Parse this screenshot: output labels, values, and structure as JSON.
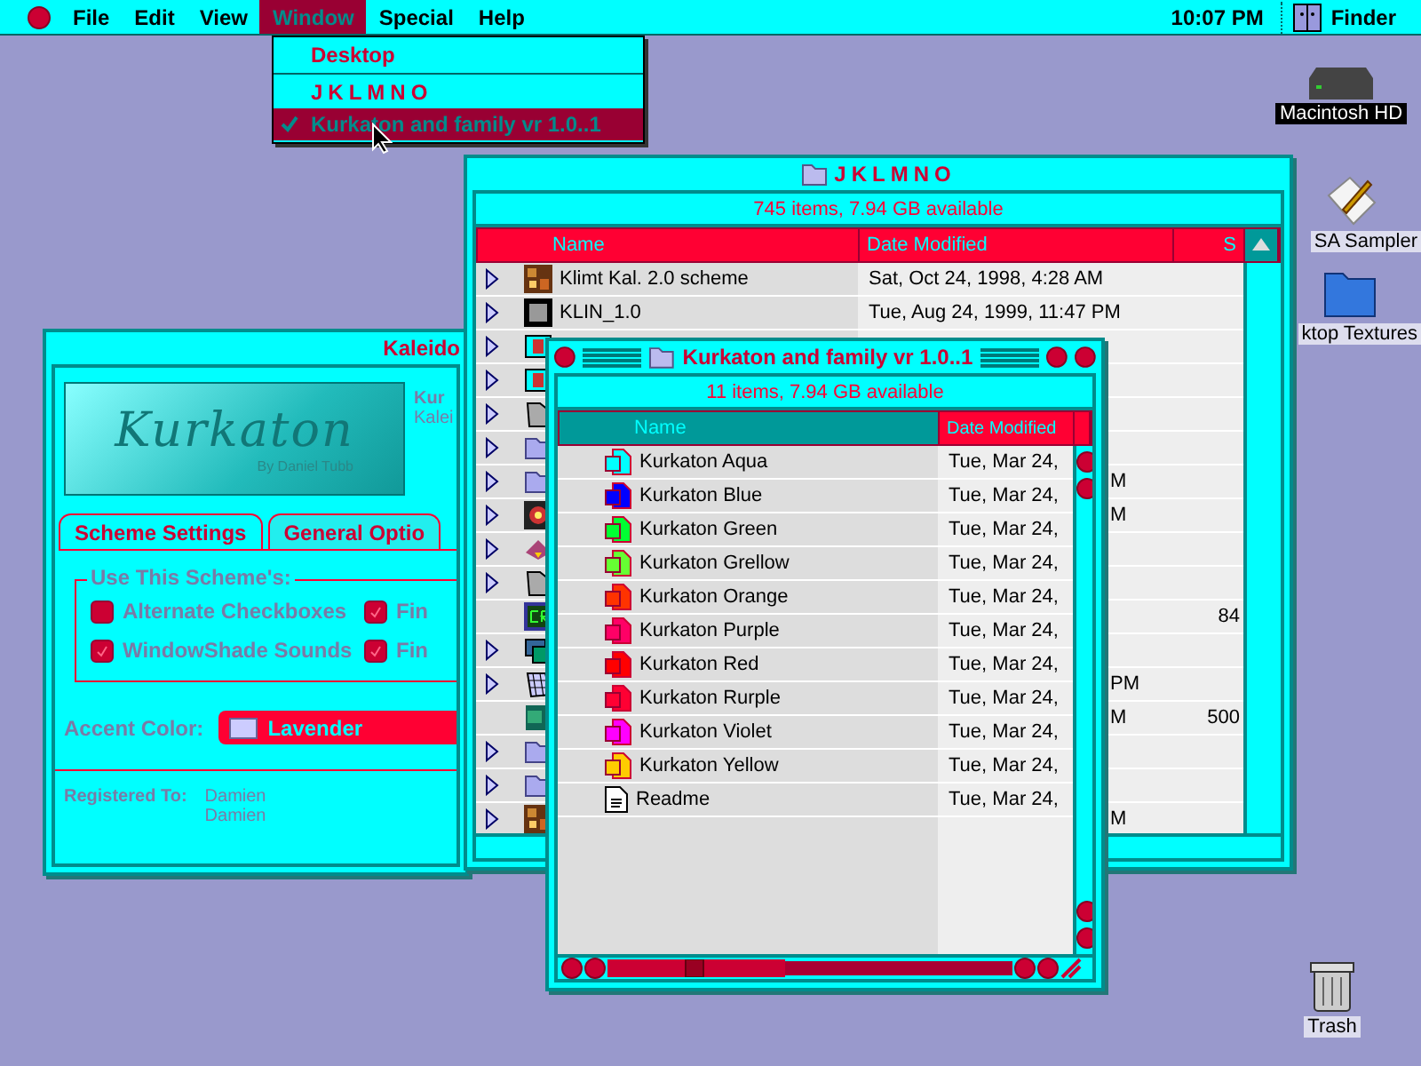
{
  "menu_bar": {
    "menus": [
      {
        "label": "File",
        "selected": false
      },
      {
        "label": "Edit",
        "selected": false
      },
      {
        "label": "View",
        "selected": false
      },
      {
        "label": "Window",
        "selected": true
      },
      {
        "label": "Special",
        "selected": false
      },
      {
        "label": "Help",
        "selected": false
      }
    ],
    "clock": "10:07 PM",
    "app": "Finder"
  },
  "window_menu": {
    "items": [
      {
        "kind": "item",
        "label": "Desktop",
        "checked": false,
        "selected": false
      },
      {
        "kind": "separator"
      },
      {
        "kind": "item",
        "label": "JKLMNO",
        "checked": false,
        "selected": false
      },
      {
        "kind": "item",
        "label": "Kurkaton and family vr 1.0..1",
        "checked": true,
        "selected": true
      }
    ]
  },
  "desktop_icons": [
    {
      "kind": "drive",
      "label": "Macintosh HD",
      "selected": true
    },
    {
      "kind": "app",
      "label": "SA Sampler",
      "selected": false
    },
    {
      "kind": "folder",
      "label": "ktop Textures",
      "selected": false
    },
    {
      "kind": "trash",
      "label": "Trash",
      "selected": false
    }
  ],
  "kaleidoscope_window": {
    "title": "Kaleido",
    "logo": {
      "title": "Kurkaton",
      "byline": "By Daniel Tubb"
    },
    "info": [
      "Kur",
      "Kalei"
    ],
    "tabs": [
      {
        "label": "Scheme Settings",
        "selected": true
      },
      {
        "label": "General Optio",
        "selected": false
      }
    ],
    "group": {
      "title": "Use This Scheme's:",
      "options": [
        {
          "label": "Alternate Checkboxes",
          "checked": false
        },
        {
          "label": "Fin",
          "checked": true
        },
        {
          "label": "WindowShade Sounds",
          "checked": true
        },
        {
          "label": "Fin",
          "checked": true
        }
      ]
    },
    "accent": {
      "label": "Accent Color:",
      "value": "Lavender"
    },
    "registered": {
      "label": "Registered To:",
      "lines": [
        "Damien",
        "Damien"
      ]
    }
  },
  "jklmno_window": {
    "title": "JKLMNO",
    "info": "745 items, 7.94 GB available",
    "columns": [
      "Name",
      "Date Modified",
      "S"
    ],
    "rows": [
      {
        "kind": "mosaic",
        "expandable": true,
        "name": "Klimt Kal. 2.0 scheme",
        "date": "Sat, Oct 24, 1998, 4:28 AM"
      },
      {
        "kind": "klin",
        "expandable": true,
        "name": "KLIN_1.0",
        "date": "Tue, Aug 24, 1999, 11:47 PM"
      },
      {
        "kind": "app",
        "expandable": true
      },
      {
        "kind": "app",
        "expandable": true
      },
      {
        "kind": "dark-folder",
        "expandable": true
      },
      {
        "kind": "folder",
        "expandable": true
      },
      {
        "kind": "folder",
        "expandable": true,
        "date": "M"
      },
      {
        "kind": "emblem",
        "expandable": true,
        "date": "M"
      },
      {
        "kind": "pyramid",
        "expandable": true
      },
      {
        "kind": "dark-folder",
        "expandable": true
      },
      {
        "kind": "cr",
        "expandable": false,
        "size": "84"
      },
      {
        "kind": "stack",
        "expandable": true
      },
      {
        "kind": "grid",
        "expandable": true,
        "date": "PM"
      },
      {
        "kind": "k-app",
        "expandable": false,
        "date": "M",
        "size": "500"
      },
      {
        "kind": "folder",
        "expandable": true
      },
      {
        "kind": "folder",
        "expandable": true
      },
      {
        "kind": "mosaic",
        "expandable": true,
        "date": "M"
      }
    ]
  },
  "kurkaton_window": {
    "title": "Kurkaton and family vr 1.0..1",
    "info": "11 items, 7.94 GB available",
    "columns": [
      "Name",
      "Date Modified"
    ],
    "rows": [
      {
        "kind": "scheme",
        "name": "Kurkaton Aqua",
        "date": "Tue, Mar 24,",
        "color": "#00ffff"
      },
      {
        "kind": "scheme",
        "name": "Kurkaton Blue",
        "date": "Tue, Mar 24,",
        "color": "#0000ff"
      },
      {
        "kind": "scheme",
        "name": "Kurkaton Green",
        "date": "Tue, Mar 24,",
        "color": "#00ff33"
      },
      {
        "kind": "scheme",
        "name": "Kurkaton Grellow",
        "date": "Tue, Mar 24,",
        "color": "#66ff33"
      },
      {
        "kind": "scheme",
        "name": "Kurkaton Orange",
        "date": "Tue, Mar 24,",
        "color": "#ff3300"
      },
      {
        "kind": "scheme",
        "name": "Kurkaton Purple",
        "date": "Tue, Mar 24,",
        "color": "#ff0066"
      },
      {
        "kind": "scheme",
        "name": "Kurkaton Red",
        "date": "Tue, Mar 24,",
        "color": "#ff0000"
      },
      {
        "kind": "scheme",
        "name": "Kurkaton Rurple",
        "date": "Tue, Mar 24,",
        "color": "#ff0033"
      },
      {
        "kind": "scheme",
        "name": "Kurkaton Violet",
        "date": "Tue, Mar 24,",
        "color": "#ff00ff"
      },
      {
        "kind": "scheme",
        "name": "Kurkaton Yellow",
        "date": "Tue, Mar 24,",
        "color": "#ffcc00"
      },
      {
        "kind": "text",
        "name": "Readme",
        "date": "Tue, Mar 24,"
      }
    ]
  }
}
